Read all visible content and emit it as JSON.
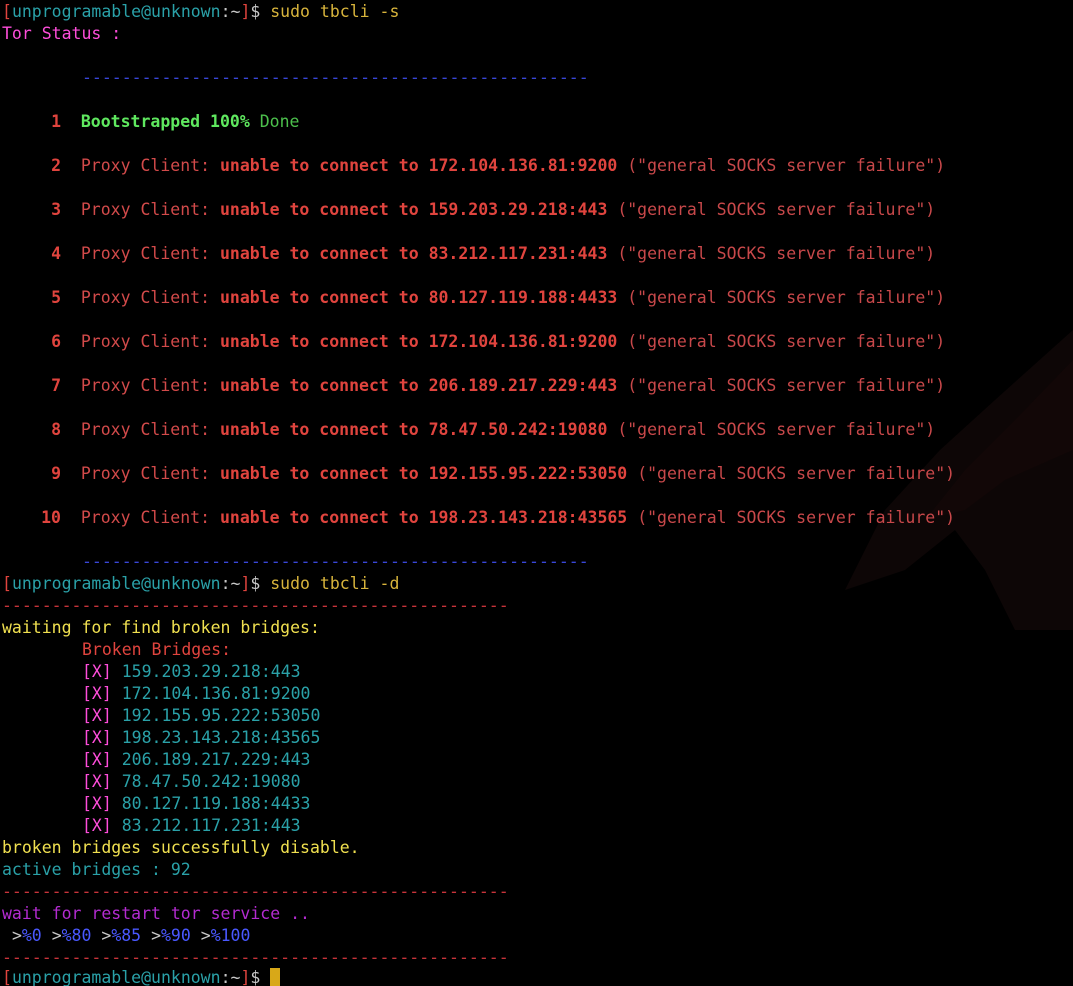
{
  "terminal": {
    "prompt": {
      "user_host": "unprogramable@unknown",
      "path": "~",
      "symbol": "$"
    },
    "cmd_status": "sudo tbcli -s",
    "tor_status_label": "Tor Status :",
    "sep_status": "---------------------------------------------------",
    "sep_main": "---------------------------------------------------",
    "status_rows": [
      {
        "n": "1",
        "label": "Bootstrapped",
        "percent": "100%",
        "text": "Done"
      },
      {
        "n": "2",
        "label": "Proxy Client:",
        "msg": "unable to connect to 172.104.136.81:9200",
        "err": "(\"general SOCKS server failure\")"
      },
      {
        "n": "3",
        "label": "Proxy Client:",
        "msg": "unable to connect to 159.203.29.218:443",
        "err": "(\"general SOCKS server failure\")"
      },
      {
        "n": "4",
        "label": "Proxy Client:",
        "msg": "unable to connect to 83.212.117.231:443",
        "err": "(\"general SOCKS server failure\")"
      },
      {
        "n": "5",
        "label": "Proxy Client:",
        "msg": "unable to connect to 80.127.119.188:4433",
        "err": "(\"general SOCKS server failure\")"
      },
      {
        "n": "6",
        "label": "Proxy Client:",
        "msg": "unable to connect to 172.104.136.81:9200",
        "err": "(\"general SOCKS server failure\")"
      },
      {
        "n": "7",
        "label": "Proxy Client:",
        "msg": "unable to connect to 206.189.217.229:443",
        "err": "(\"general SOCKS server failure\")"
      },
      {
        "n": "8",
        "label": "Proxy Client:",
        "msg": "unable to connect to 78.47.50.242:19080",
        "err": "(\"general SOCKS server failure\")"
      },
      {
        "n": "9",
        "label": "Proxy Client:",
        "msg": "unable to connect to 192.155.95.222:53050",
        "err": "(\"general SOCKS server failure\")"
      },
      {
        "n": "10",
        "label": "Proxy Client:",
        "msg": "unable to connect to 198.23.143.218:43565",
        "err": "(\"general SOCKS server failure\")"
      }
    ],
    "cmd_disable": "sudo tbcli -d",
    "waiting_text": "waiting for find broken bridges:",
    "broken_title": "Broken Bridges:",
    "broken_marker": "[X]",
    "broken_bridges": [
      "159.203.29.218:443",
      "172.104.136.81:9200",
      "192.155.95.222:53050",
      "198.23.143.218:43565",
      "206.189.217.229:443",
      "78.47.50.242:19080",
      "80.127.119.188:4433",
      "83.212.117.231:443"
    ],
    "disabled_text": "broken bridges successfully disable.",
    "active_text": "active bridges : 92",
    "restart_text": "wait for restart tor service ..",
    "progress_marker": ">",
    "progress_steps": [
      "%0",
      "%80",
      "%85",
      "%90",
      "%100"
    ]
  },
  "colors": {
    "background": "#000000",
    "prompt_bracket": "#e0443e",
    "prompt_user": "#2aa1a8",
    "command": "#d8b43c",
    "success": "#5fe85f",
    "error": "#e0443e",
    "bridge_ip": "#2aa1a8",
    "cursor": "#d8a818"
  }
}
